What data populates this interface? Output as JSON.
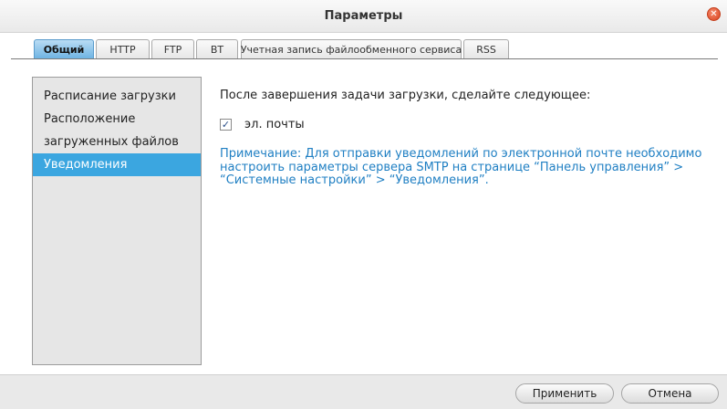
{
  "window": {
    "title": "Параметры",
    "close_glyph": "✕"
  },
  "tabs": [
    {
      "label": "Общий"
    },
    {
      "label": "HTTP"
    },
    {
      "label": "FTP"
    },
    {
      "label": "BT"
    },
    {
      "label": "Учетная запись файлообменного сервиса"
    },
    {
      "label": "RSS"
    }
  ],
  "sidebar": {
    "items": [
      {
        "label": "Расписание загрузки"
      },
      {
        "label": "Расположение"
      },
      {
        "label": "загруженных файлов"
      },
      {
        "label": "Уведомления"
      }
    ]
  },
  "main": {
    "heading": "После завершения задачи загрузки, сделайте следующее:",
    "email_checkbox": {
      "label": "эл. почты",
      "checked": true,
      "check_glyph": "✓"
    },
    "note_lines": [
      "Примечание: Для отправки уведомлений по электронной почте необходимо",
      "настроить параметры сервера SMTP на странице “Панель управления” >",
      "“Системные настройки” > “Уведомления”."
    ]
  },
  "footer": {
    "apply_label": "Применить",
    "cancel_label": "Отмена"
  },
  "colors": {
    "accent": "#3ba6e0",
    "note_text": "#1f7fc3",
    "close_button": "#d9431f"
  }
}
